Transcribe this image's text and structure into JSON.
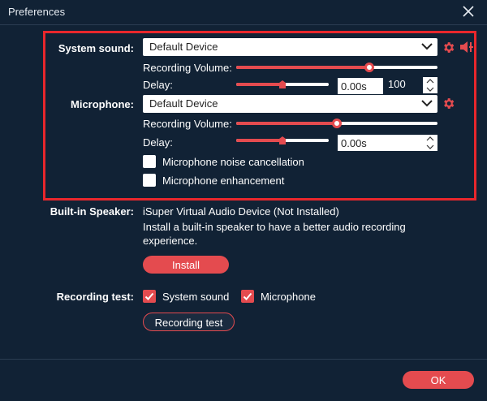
{
  "window": {
    "title": "Preferences"
  },
  "system_sound": {
    "label": "System sound:",
    "device": "Default Device",
    "recording_volume_label": "Recording Volume:",
    "recording_volume": 0.66,
    "delay_label": "Delay:",
    "delay_level": 0.5,
    "delay_value": "0.00s",
    "delay_max": "100"
  },
  "microphone": {
    "label": "Microphone:",
    "device": "Default Device",
    "recording_volume_label": "Recording Volume:",
    "recording_volume": 0.5,
    "delay_label": "Delay:",
    "delay_level": 0.5,
    "delay_value": "0.00s",
    "noise_cancellation_label": "Microphone noise cancellation",
    "noise_cancellation_checked": false,
    "enhancement_label": "Microphone enhancement",
    "enhancement_checked": false
  },
  "builtin_speaker": {
    "label": "Built-in Speaker:",
    "device_status": "iSuper Virtual Audio Device (Not Installed)",
    "description_line1": "Install a built-in speaker to have a better audio recording",
    "description_line2": "experience.",
    "install_label": "Install"
  },
  "recording_test": {
    "label": "Recording test:",
    "system_sound_label": "System sound",
    "system_sound_checked": true,
    "microphone_label": "Microphone",
    "microphone_checked": true,
    "button_label": "Recording test"
  },
  "footer": {
    "ok_label": "OK"
  },
  "colors": {
    "background": "#112235",
    "accent": "#e44b4f",
    "highlight_box": "#e8272c"
  },
  "icons": [
    "close-icon",
    "chevron-down-icon",
    "gear-icon",
    "speaker-icon",
    "checkmark-icon",
    "spin-up-icon",
    "spin-down-icon"
  ]
}
